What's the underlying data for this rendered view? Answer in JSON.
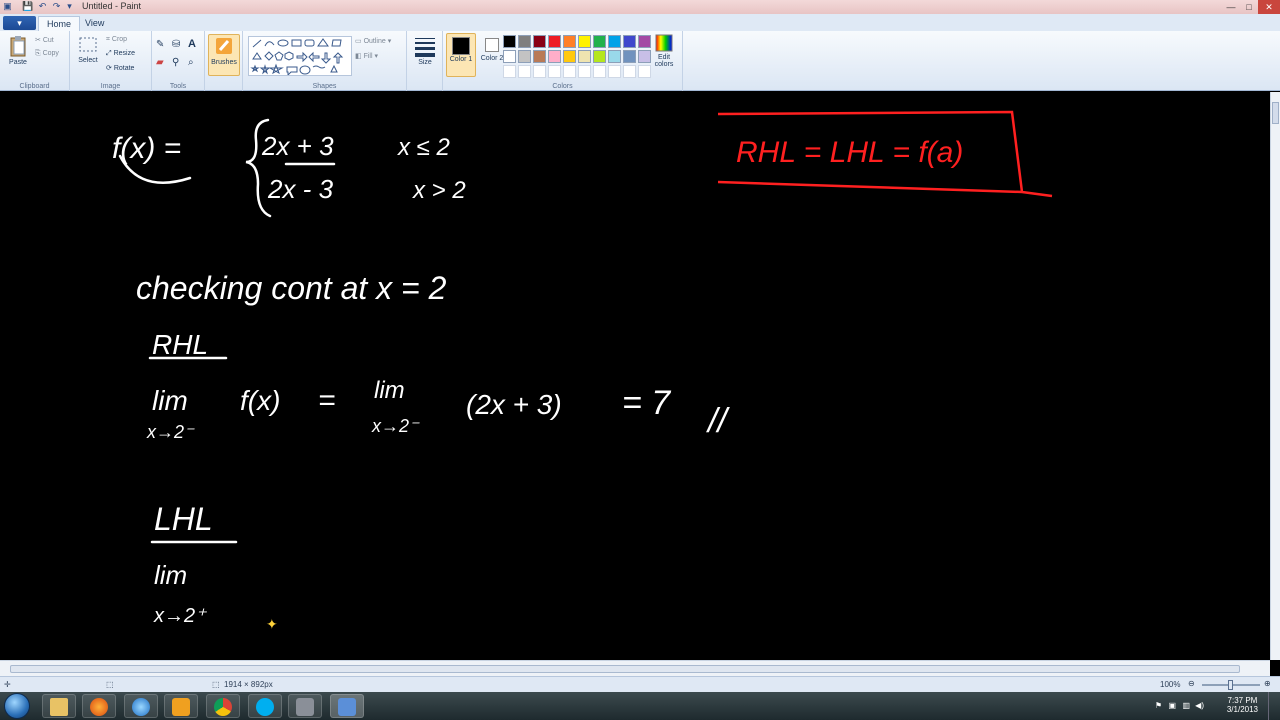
{
  "window": {
    "title": "Untitled - Paint",
    "minimize_icon": "minimize-icon",
    "maximize_icon": "maximize-icon",
    "close_icon": "close-icon"
  },
  "tabs": {
    "app_menu_label": "▾",
    "home": "Home",
    "view": "View"
  },
  "ribbon": {
    "clipboard": {
      "label": "Clipboard",
      "paste": "Paste",
      "cut": "Cut",
      "copy": "Copy"
    },
    "image": {
      "label": "Image",
      "select": "Select",
      "crop": "Crop",
      "resize": "Resize",
      "rotate": "Rotate"
    },
    "tools": {
      "label": "Tools"
    },
    "brushes": {
      "label": "Brushes"
    },
    "shapes": {
      "label": "Shapes",
      "outline": "Outline",
      "fill": "Fill"
    },
    "size": {
      "label": "Size"
    },
    "colors": {
      "label": "Colors",
      "color1": "Color 1",
      "color2": "Color 2",
      "edit": "Edit colors"
    }
  },
  "palette": {
    "row1": [
      "#000000",
      "#7f7f7f",
      "#880015",
      "#ed1c24",
      "#ff7f27",
      "#fff200",
      "#22b14c",
      "#00a2e8",
      "#3f48cc",
      "#a349a4"
    ],
    "row2": [
      "#ffffff",
      "#c3c3c3",
      "#b97a57",
      "#ffaec9",
      "#ffc90e",
      "#efe4b0",
      "#b5e61d",
      "#99d9ea",
      "#7092be",
      "#c8bfe7"
    ],
    "color1_value": "#000000",
    "color2_value": "#ffffff"
  },
  "canvas": {
    "background": "#000000",
    "ink_white": "#ffffff",
    "ink_red": "#ff2020",
    "handwriting": {
      "function_def_left": "f(x) =",
      "piece1_expr": "2x + 3",
      "piece1_cond": "x ≤ 2",
      "piece2_expr": "2x - 3",
      "piece2_cond": "x > 2",
      "continuity_condition": "RHL = LHL = f(a)",
      "heading": "checking cont at x = 2",
      "rhl_label": "RHL",
      "rhl_lim": "lim",
      "rhl_sub": "x→2⁻",
      "rhl_fx": "f(x)",
      "rhl_eq": "=",
      "rhl_lim2": "lim",
      "rhl_sub2": "x→2⁻",
      "rhl_expr": "(2x + 3)",
      "rhl_result": "= 7",
      "rhl_mark": "//",
      "lhl_label": "LHL",
      "lhl_lim": "lim",
      "lhl_sub": "x→2⁺"
    }
  },
  "statusbar": {
    "image_size": "1914 × 892px",
    "zoom": "100%"
  },
  "taskbar": {
    "time": "7:37 PM",
    "date": "3/1/2013"
  }
}
